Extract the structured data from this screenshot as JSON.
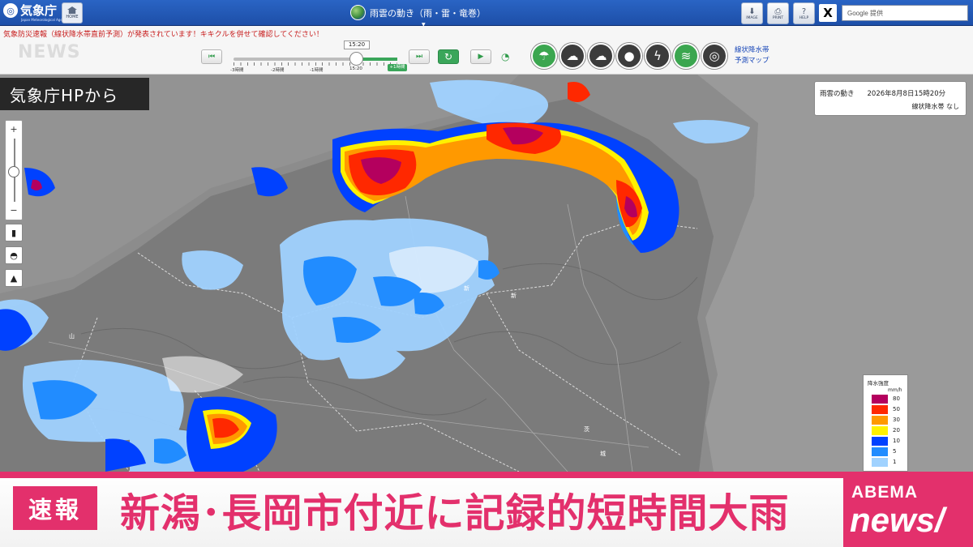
{
  "header": {
    "logo_text": "気象庁",
    "logo_sub": "Japan Meteorological Agency",
    "home_label": "HOME",
    "page_title": "雨雲の動き（雨・雷・竜巻）",
    "buttons": [
      {
        "label": "IMAGE",
        "icon": "download-icon"
      },
      {
        "label": "PRINT",
        "icon": "print-icon"
      },
      {
        "label": "HELP",
        "icon": "help-icon"
      }
    ],
    "social_label": "X",
    "search_placeholder": "Google 提供"
  },
  "controls": {
    "warning_text": "気象防災速報（線状降水帯直前予測）が発表されています！キキクルを併せて確認してください！",
    "current_time": "15:20",
    "tick_labels": [
      "-3時間",
      "-2時間",
      "-1時間",
      "15:20"
    ],
    "forecast_label": "+1時間",
    "layer_buttons": [
      {
        "icon": "rain-cloud-icon",
        "active": true
      },
      {
        "icon": "thunder-cloud-icon",
        "active": false
      },
      {
        "icon": "tornado-cloud-icon",
        "active": false
      },
      {
        "icon": "raindrop-icon",
        "active": false
      },
      {
        "icon": "lightning-icon",
        "active": false
      },
      {
        "icon": "wind-icon",
        "active": true
      },
      {
        "icon": "radar-icon",
        "active": false
      }
    ],
    "side_links": [
      "線状降水帯",
      "予測マップ"
    ],
    "ghost_logo": "NEWS"
  },
  "source_badge": "気象庁HPから",
  "map_info": {
    "title": "雨雲の動き",
    "timestamp": "2026年8月8日15時20分",
    "status": "線状降水帯 なし"
  },
  "legend": {
    "title": "降水強度",
    "unit": "mm/h",
    "entries": [
      {
        "label": "80",
        "color": "#b4005e"
      },
      {
        "label": "50",
        "color": "#ff2800"
      },
      {
        "label": "30",
        "color": "#ff9900"
      },
      {
        "label": "20",
        "color": "#fff100"
      },
      {
        "label": "10",
        "color": "#0041ff"
      },
      {
        "label": "5",
        "color": "#218cff"
      },
      {
        "label": "1",
        "color": "#a0d2ff"
      }
    ]
  },
  "ticker": {
    "badge": "速報",
    "headline": "新潟･長岡市付近に記録的短時間大雨",
    "brand_top": "ABEMA",
    "brand_bottom": "news/"
  },
  "colors": {
    "accent_pink": "#e3306c",
    "header_blue": "#1d4fa8",
    "active_green": "#3aa65a"
  }
}
